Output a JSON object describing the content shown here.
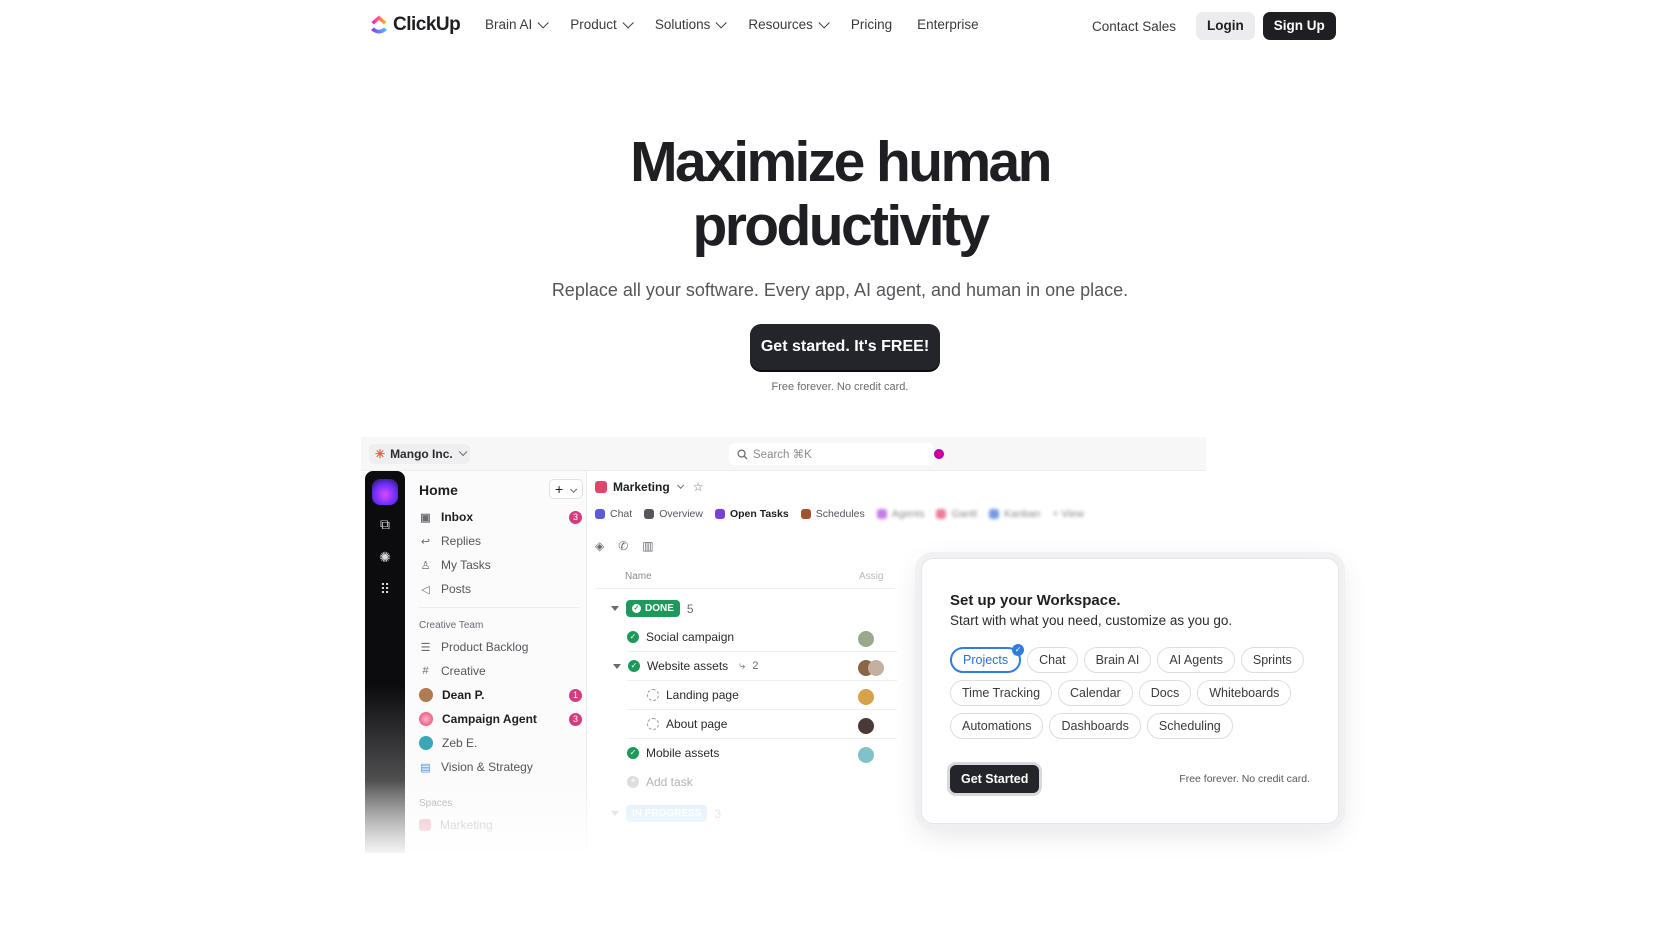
{
  "brand": {
    "name": "ClickUp"
  },
  "nav": {
    "menu": [
      {
        "label": "Brain AI",
        "dropdown": true
      },
      {
        "label": "Product",
        "dropdown": true
      },
      {
        "label": "Solutions",
        "dropdown": true
      },
      {
        "label": "Resources",
        "dropdown": true
      },
      {
        "label": "Pricing",
        "dropdown": false
      },
      {
        "label": "Enterprise",
        "dropdown": false
      }
    ],
    "contact": "Contact Sales",
    "login": "Login",
    "signup": "Sign Up"
  },
  "hero": {
    "title_line1": "Maximize human",
    "title_line2": "productivity",
    "subtitle": "Replace all your software. Every app, AI agent, and human in one place.",
    "cta": "Get started. It's FREE!",
    "cta_note": "Free forever. No credit card."
  },
  "app": {
    "workspace": "Mango Inc.",
    "search_placeholder": "Search ⌘K",
    "sidebar": {
      "title": "Home",
      "add": "+",
      "items": [
        {
          "label": "Inbox",
          "icon": "inbox-icon",
          "bold": true,
          "badge": "3"
        },
        {
          "label": "Replies",
          "icon": "reply-icon"
        },
        {
          "label": "My Tasks",
          "icon": "user-icon"
        },
        {
          "label": "Posts",
          "icon": "megaphone-icon"
        }
      ],
      "section_title": "Creative Team",
      "team_items": [
        {
          "label": "Product Backlog",
          "icon": "checklist-icon"
        },
        {
          "label": "Creative",
          "icon": "hash-icon"
        },
        {
          "label": "Dean P.",
          "icon": "avatar",
          "bold": true,
          "badge": "1"
        },
        {
          "label": "Campaign Agent",
          "icon": "avatar",
          "bold": true,
          "badge": "3"
        },
        {
          "label": "Zeb E.",
          "icon": "avatar"
        },
        {
          "label": "Vision & Strategy",
          "icon": "doc-icon"
        }
      ],
      "spaces_title": "Spaces",
      "spaces": [
        {
          "label": "Marketing"
        }
      ]
    },
    "main": {
      "breadcrumb": "Marketing",
      "tabs": [
        {
          "label": "Chat",
          "color": "#5b5bd6"
        },
        {
          "label": "Overview",
          "color": "#55555c"
        },
        {
          "label": "Open Tasks",
          "color": "#7a3fd6",
          "active": true
        },
        {
          "label": "Schedules",
          "color": "#a0522d"
        },
        {
          "label": "Agents",
          "color": "#b33fd6",
          "blur": true
        },
        {
          "label": "Gantt",
          "color": "#e0466a",
          "blur": true
        },
        {
          "label": "Kanban",
          "color": "#3f6fd6",
          "blur": true
        },
        {
          "label": "+ View",
          "color": "#8b8b92",
          "blur": true
        }
      ],
      "column_name": "Name",
      "column_assignee": "Assig",
      "group_done": {
        "label": "DONE",
        "count": "5"
      },
      "tasks": [
        {
          "label": "Social campaign",
          "status": "done",
          "level": 0
        },
        {
          "label": "Website assets",
          "status": "done",
          "level": 0,
          "subtasks": "2"
        },
        {
          "label": "Landing page",
          "status": "todo",
          "level": 1
        },
        {
          "label": "About page",
          "status": "todo",
          "level": 1
        },
        {
          "label": "Mobile assets",
          "status": "done",
          "level": 0
        }
      ],
      "add_task": "Add task",
      "group_progress": {
        "label": "IN PROGRESS",
        "count": "3"
      }
    }
  },
  "card": {
    "title": "Set up your Workspace.",
    "subtitle": "Start with what you need, customize as you go.",
    "chips": [
      {
        "label": "Projects",
        "selected": true
      },
      {
        "label": "Chat"
      },
      {
        "label": "Brain AI"
      },
      {
        "label": "AI Agents"
      },
      {
        "label": "Sprints"
      },
      {
        "label": "Time Tracking"
      },
      {
        "label": "Calendar"
      },
      {
        "label": "Docs"
      },
      {
        "label": "Whiteboards"
      },
      {
        "label": "Automations"
      },
      {
        "label": "Dashboards"
      },
      {
        "label": "Scheduling"
      }
    ],
    "button": "Get Started",
    "note": "Free forever. No credit card."
  },
  "colors": {
    "primary_dark": "#24252a",
    "accent_blue": "#2f7de1",
    "done_green": "#1d9a5b",
    "badge_pink": "#d63b7d"
  }
}
